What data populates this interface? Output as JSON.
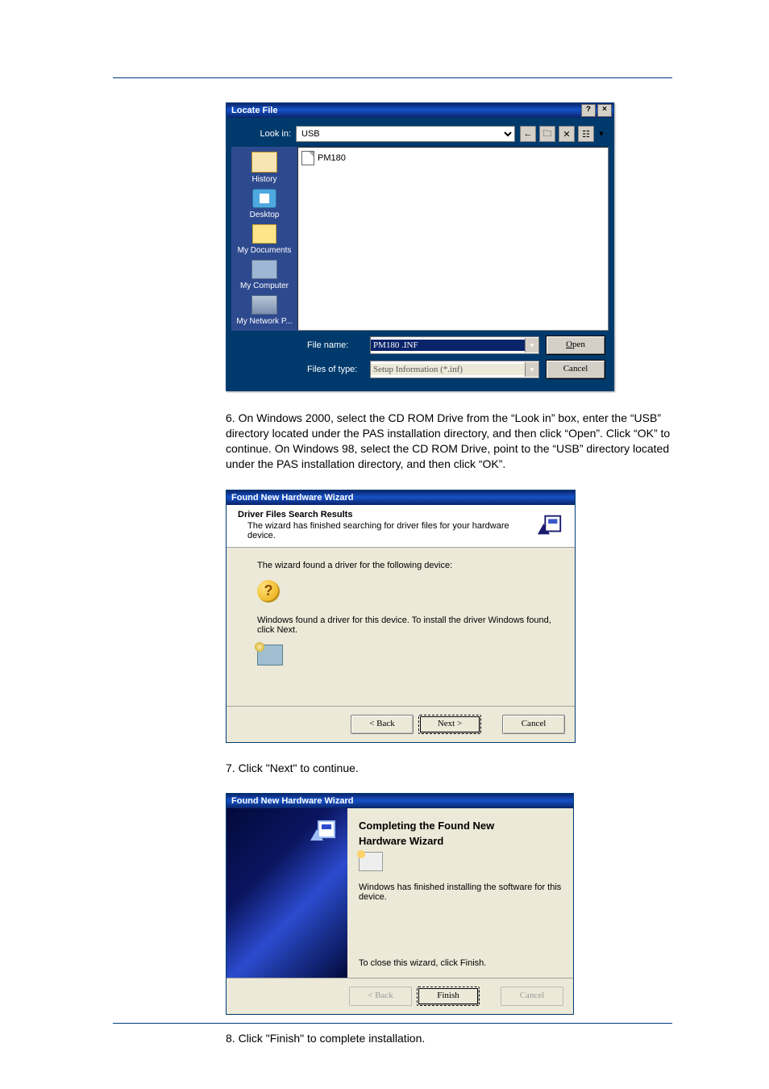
{
  "locate_file": {
    "title": "Locate File",
    "help_btn": "?",
    "close_btn": "×",
    "look_in_label": "Look in:",
    "look_in_value": "USB",
    "nav_icons": [
      "←",
      "🗀",
      "✕",
      "☷",
      "▾"
    ],
    "sidebar": [
      {
        "label": "History"
      },
      {
        "label": "Desktop"
      },
      {
        "label": "My Documents"
      },
      {
        "label": "My Computer"
      },
      {
        "label": "My Network P..."
      }
    ],
    "files": [
      "PM180"
    ],
    "file_name_label": "File name:",
    "file_name_value": "PM180 .INF",
    "file_type_label": "Files of type:",
    "file_type_value": "Setup Information (*.inf)",
    "open_btn": "Open",
    "cancel_btn": "Cancel"
  },
  "para6": "6. On Windows 2000, select the CD ROM Drive from the “Look in” box, enter the “USB” directory located under the PAS installation directory, and then click “Open”. Click “OK” to continue. On Windows 98, select the CD ROM Drive, point to the “USB” directory located under the PAS installation directory, and then click “OK”.",
  "wizard1": {
    "title": "Found New Hardware Wizard",
    "header_title": "Driver Files Search Results",
    "header_sub": "The wizard has finished searching for driver files for your hardware device.",
    "line1": "The wizard found a driver for the following device:",
    "line2": "Windows found a driver for this device. To install the driver Windows found, click Next.",
    "back_btn": "< Back",
    "next_btn": "Next >",
    "cancel_btn": "Cancel"
  },
  "para7": "7. Click \"Next\" to continue.",
  "wizard2": {
    "title": "Found New Hardware Wizard",
    "heading1": "Completing the Found New",
    "heading2": "Hardware Wizard",
    "body_line": "Windows has finished installing the software for this device.",
    "close_line": "To close this wizard, click Finish.",
    "back_btn": "< Back",
    "finish_btn": "Finish",
    "cancel_btn": "Cancel"
  },
  "para8": "8. Click \"Finish\" to complete installation."
}
